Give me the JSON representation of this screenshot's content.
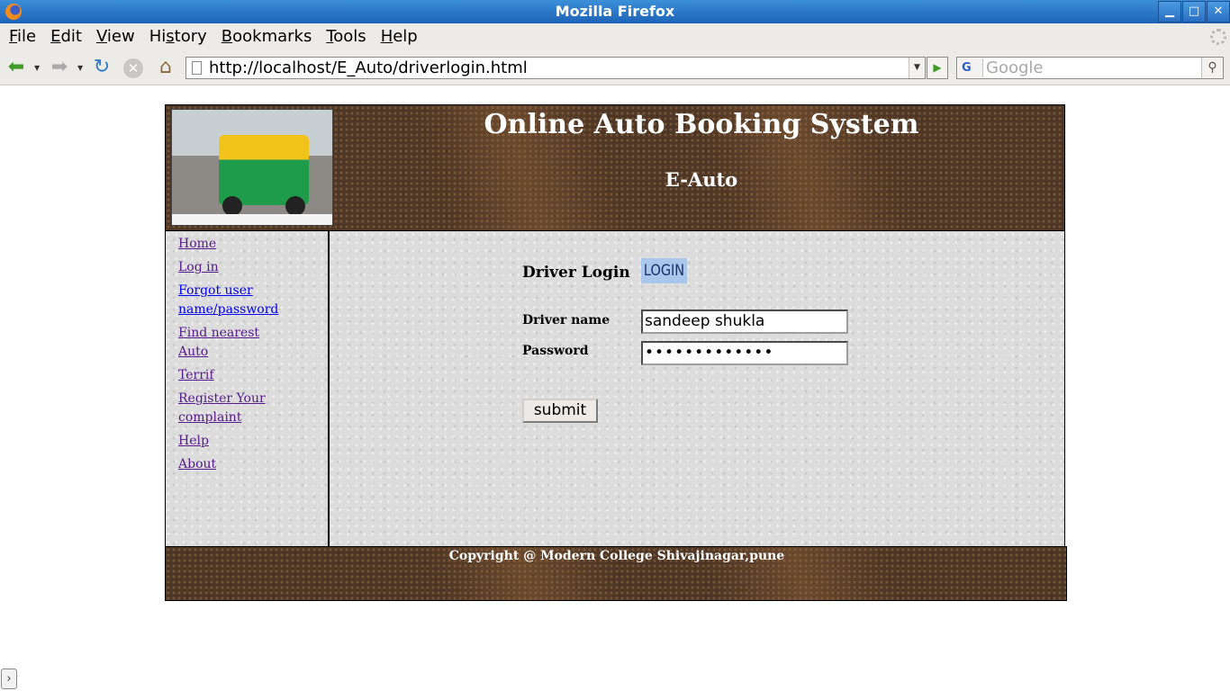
{
  "window": {
    "title": "Mozilla Firefox",
    "minimize": "▁",
    "maximize": "□",
    "close": "✕"
  },
  "menu": {
    "file_first": "F",
    "file_rest": "ile",
    "edit_first": "E",
    "edit_rest": "dit",
    "view_first": "V",
    "view_rest": "iew",
    "history_pre": "Hi",
    "history_u": "s",
    "history_rest": "tory",
    "bookmarks_first": "B",
    "bookmarks_rest": "ookmarks",
    "tools_first": "T",
    "tools_rest": "ools",
    "help_first": "H",
    "help_rest": "elp"
  },
  "toolbar": {
    "url": "http://localhost/E_Auto/driverlogin.html",
    "search_placeholder": "Google",
    "search_engine": "G"
  },
  "icons": {
    "back": "back-arrow-icon",
    "forward": "forward-arrow-icon",
    "reload": "reload-icon",
    "stop": "stop-icon",
    "home": "home-icon",
    "go": "go-arrow-icon",
    "search": "magnifier-icon"
  },
  "header": {
    "title": "Online Auto Booking System",
    "subtitle": "E-Auto"
  },
  "sidebar": {
    "items": [
      {
        "label": "Home"
      },
      {
        "label": "Log in"
      },
      {
        "label": "Forgot user name/password"
      },
      {
        "label": "Find nearest Auto"
      },
      {
        "label": "Terrif"
      },
      {
        "label": "Register Your complaint"
      },
      {
        "label": "Help"
      },
      {
        "label": "About"
      }
    ]
  },
  "login": {
    "heading": "Driver Login",
    "badge": "LOGIN",
    "driver_label": "Driver name",
    "driver_value": "sandeep shukla",
    "password_label": "Password",
    "password_masked": "•••••••••••••",
    "submit": "submit"
  },
  "footer": {
    "copyright": "Copyright @ Modern College Shivajinagar,pune"
  },
  "colors": {
    "titlebar": "#1c63b7",
    "link_visited": "#551a8b",
    "link_unvisited": "#0000ee",
    "wood": "#4d3625",
    "paper": "#dcdcdc"
  }
}
